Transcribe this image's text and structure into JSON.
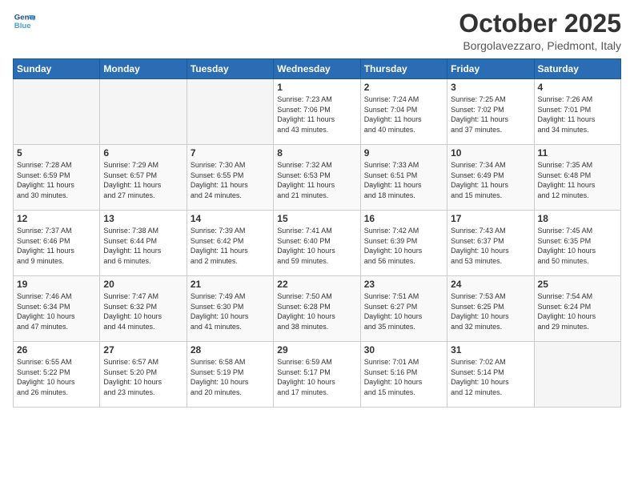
{
  "header": {
    "logo_line1": "General",
    "logo_line2": "Blue",
    "month": "October 2025",
    "location": "Borgolavezzaro, Piedmont, Italy"
  },
  "weekdays": [
    "Sunday",
    "Monday",
    "Tuesday",
    "Wednesday",
    "Thursday",
    "Friday",
    "Saturday"
  ],
  "weeks": [
    [
      {
        "day": "",
        "info": ""
      },
      {
        "day": "",
        "info": ""
      },
      {
        "day": "",
        "info": ""
      },
      {
        "day": "1",
        "info": "Sunrise: 7:23 AM\nSunset: 7:06 PM\nDaylight: 11 hours\nand 43 minutes."
      },
      {
        "day": "2",
        "info": "Sunrise: 7:24 AM\nSunset: 7:04 PM\nDaylight: 11 hours\nand 40 minutes."
      },
      {
        "day": "3",
        "info": "Sunrise: 7:25 AM\nSunset: 7:02 PM\nDaylight: 11 hours\nand 37 minutes."
      },
      {
        "day": "4",
        "info": "Sunrise: 7:26 AM\nSunset: 7:01 PM\nDaylight: 11 hours\nand 34 minutes."
      }
    ],
    [
      {
        "day": "5",
        "info": "Sunrise: 7:28 AM\nSunset: 6:59 PM\nDaylight: 11 hours\nand 30 minutes."
      },
      {
        "day": "6",
        "info": "Sunrise: 7:29 AM\nSunset: 6:57 PM\nDaylight: 11 hours\nand 27 minutes."
      },
      {
        "day": "7",
        "info": "Sunrise: 7:30 AM\nSunset: 6:55 PM\nDaylight: 11 hours\nand 24 minutes."
      },
      {
        "day": "8",
        "info": "Sunrise: 7:32 AM\nSunset: 6:53 PM\nDaylight: 11 hours\nand 21 minutes."
      },
      {
        "day": "9",
        "info": "Sunrise: 7:33 AM\nSunset: 6:51 PM\nDaylight: 11 hours\nand 18 minutes."
      },
      {
        "day": "10",
        "info": "Sunrise: 7:34 AM\nSunset: 6:49 PM\nDaylight: 11 hours\nand 15 minutes."
      },
      {
        "day": "11",
        "info": "Sunrise: 7:35 AM\nSunset: 6:48 PM\nDaylight: 11 hours\nand 12 minutes."
      }
    ],
    [
      {
        "day": "12",
        "info": "Sunrise: 7:37 AM\nSunset: 6:46 PM\nDaylight: 11 hours\nand 9 minutes."
      },
      {
        "day": "13",
        "info": "Sunrise: 7:38 AM\nSunset: 6:44 PM\nDaylight: 11 hours\nand 6 minutes."
      },
      {
        "day": "14",
        "info": "Sunrise: 7:39 AM\nSunset: 6:42 PM\nDaylight: 11 hours\nand 2 minutes."
      },
      {
        "day": "15",
        "info": "Sunrise: 7:41 AM\nSunset: 6:40 PM\nDaylight: 10 hours\nand 59 minutes."
      },
      {
        "day": "16",
        "info": "Sunrise: 7:42 AM\nSunset: 6:39 PM\nDaylight: 10 hours\nand 56 minutes."
      },
      {
        "day": "17",
        "info": "Sunrise: 7:43 AM\nSunset: 6:37 PM\nDaylight: 10 hours\nand 53 minutes."
      },
      {
        "day": "18",
        "info": "Sunrise: 7:45 AM\nSunset: 6:35 PM\nDaylight: 10 hours\nand 50 minutes."
      }
    ],
    [
      {
        "day": "19",
        "info": "Sunrise: 7:46 AM\nSunset: 6:34 PM\nDaylight: 10 hours\nand 47 minutes."
      },
      {
        "day": "20",
        "info": "Sunrise: 7:47 AM\nSunset: 6:32 PM\nDaylight: 10 hours\nand 44 minutes."
      },
      {
        "day": "21",
        "info": "Sunrise: 7:49 AM\nSunset: 6:30 PM\nDaylight: 10 hours\nand 41 minutes."
      },
      {
        "day": "22",
        "info": "Sunrise: 7:50 AM\nSunset: 6:28 PM\nDaylight: 10 hours\nand 38 minutes."
      },
      {
        "day": "23",
        "info": "Sunrise: 7:51 AM\nSunset: 6:27 PM\nDaylight: 10 hours\nand 35 minutes."
      },
      {
        "day": "24",
        "info": "Sunrise: 7:53 AM\nSunset: 6:25 PM\nDaylight: 10 hours\nand 32 minutes."
      },
      {
        "day": "25",
        "info": "Sunrise: 7:54 AM\nSunset: 6:24 PM\nDaylight: 10 hours\nand 29 minutes."
      }
    ],
    [
      {
        "day": "26",
        "info": "Sunrise: 6:55 AM\nSunset: 5:22 PM\nDaylight: 10 hours\nand 26 minutes."
      },
      {
        "day": "27",
        "info": "Sunrise: 6:57 AM\nSunset: 5:20 PM\nDaylight: 10 hours\nand 23 minutes."
      },
      {
        "day": "28",
        "info": "Sunrise: 6:58 AM\nSunset: 5:19 PM\nDaylight: 10 hours\nand 20 minutes."
      },
      {
        "day": "29",
        "info": "Sunrise: 6:59 AM\nSunset: 5:17 PM\nDaylight: 10 hours\nand 17 minutes."
      },
      {
        "day": "30",
        "info": "Sunrise: 7:01 AM\nSunset: 5:16 PM\nDaylight: 10 hours\nand 15 minutes."
      },
      {
        "day": "31",
        "info": "Sunrise: 7:02 AM\nSunset: 5:14 PM\nDaylight: 10 hours\nand 12 minutes."
      },
      {
        "day": "",
        "info": ""
      }
    ]
  ]
}
